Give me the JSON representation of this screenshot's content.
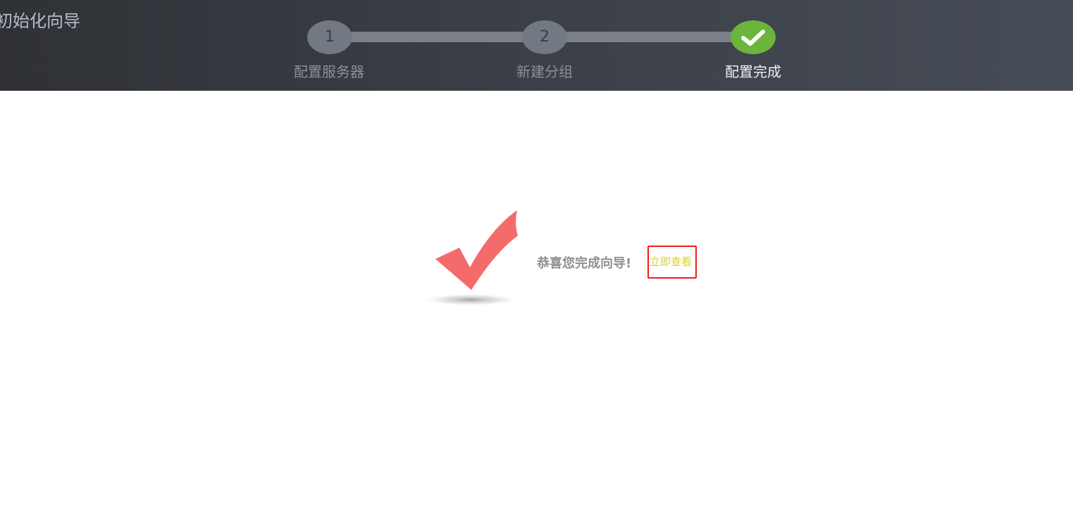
{
  "header": {
    "title": "初始化向导"
  },
  "steps": [
    {
      "number": "1",
      "label": "配置服务器",
      "state": "pending"
    },
    {
      "number": "2",
      "label": "新建分组",
      "state": "pending"
    },
    {
      "number": "",
      "label": "配置完成",
      "state": "done",
      "icon": "check-icon"
    }
  ],
  "result": {
    "icon": "big-check-icon",
    "message": "恭喜您完成向导!",
    "link_label": "立即查看"
  },
  "colors": {
    "step_done": "#6bb53a",
    "step_pending": "#737983",
    "check_mark": "#f56b6b",
    "link": "#d8d22a",
    "highlight_border": "#ee1c1c"
  }
}
